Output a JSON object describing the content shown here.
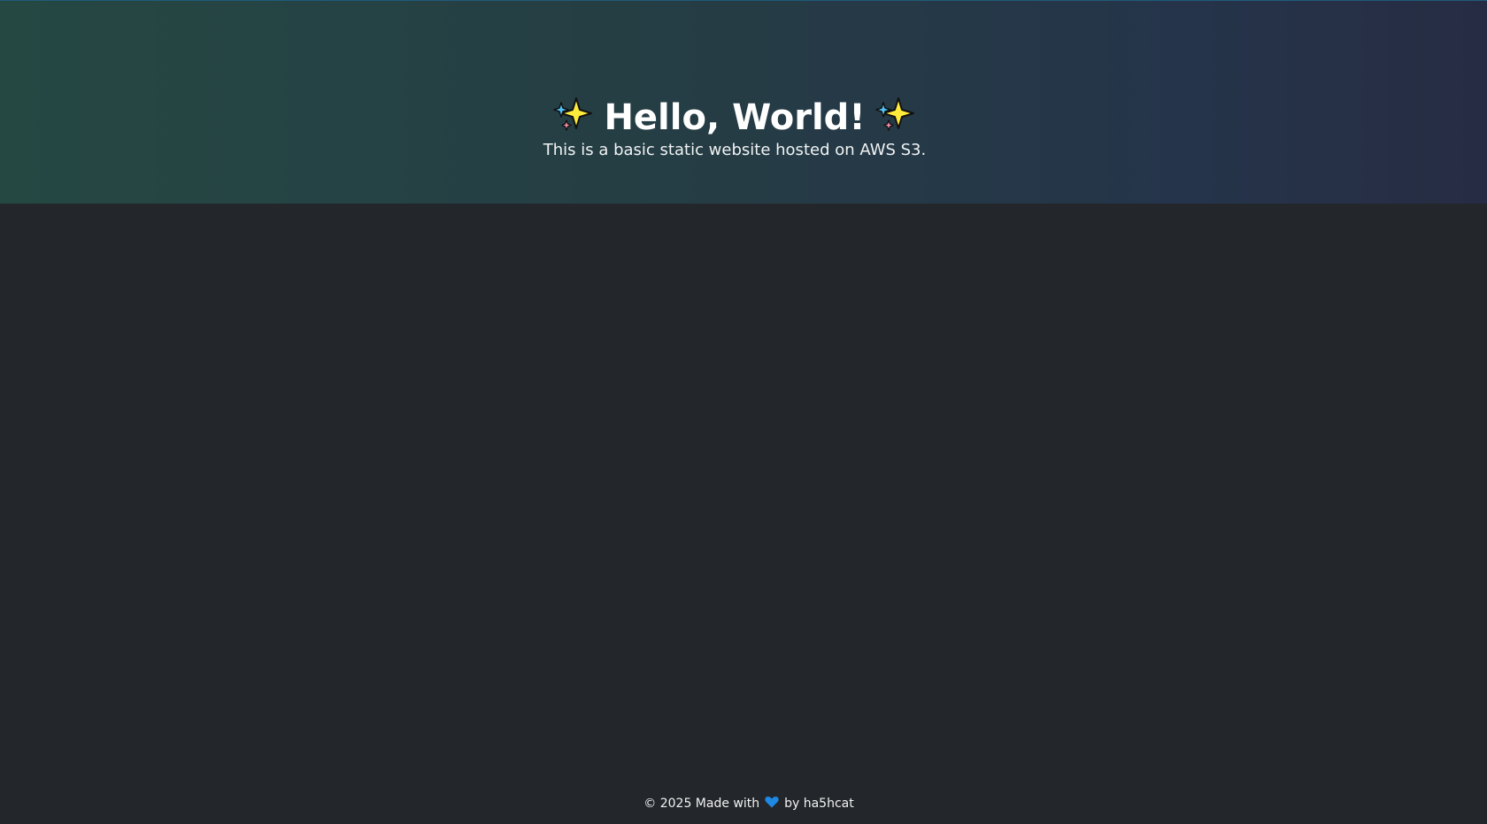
{
  "hero": {
    "title": "Hello, World!",
    "subtitle": "This is a basic static website hosted on AWS S3.",
    "decorative_icons": [
      "sparkles-icon",
      "sparkles-icon"
    ]
  },
  "footer": {
    "prefix": "© 2025 Made with",
    "icon": "blue-heart-icon",
    "suffix": "by ha5hcat"
  },
  "colors": {
    "page_background": "#23272b",
    "hero_gradient_start": "#254843",
    "hero_gradient_end": "#262c43",
    "heart": "#1e88e5",
    "sparkle_main": "#ffeb3b"
  }
}
